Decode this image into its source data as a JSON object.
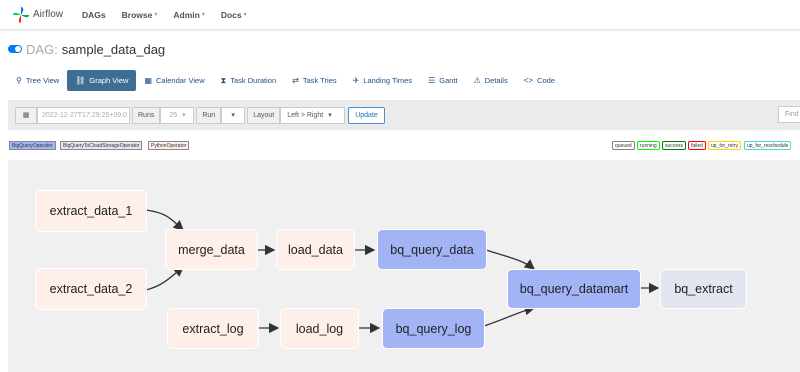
{
  "navbar": {
    "brand": "Airflow",
    "items": [
      {
        "label": "DAGs",
        "caret": false
      },
      {
        "label": "Browse",
        "caret": true
      },
      {
        "label": "Admin",
        "caret": true
      },
      {
        "label": "Docs",
        "caret": true
      }
    ]
  },
  "dag": {
    "prefix": "DAG:",
    "name": "sample_data_dag"
  },
  "tabs": [
    {
      "label": "Tree View",
      "icon": "tree-icon"
    },
    {
      "label": "Graph View",
      "icon": "graph-icon"
    },
    {
      "label": "Calendar View",
      "icon": "calendar-icon"
    },
    {
      "label": "Task Duration",
      "icon": "hourglass-icon"
    },
    {
      "label": "Task Tries",
      "icon": "refresh-icon"
    },
    {
      "label": "Landing Times",
      "icon": "plane-landing-icon"
    },
    {
      "label": "Gantt",
      "icon": "gantt-icon"
    },
    {
      "label": "Details",
      "icon": "warning-icon"
    },
    {
      "label": "Code",
      "icon": "code-icon"
    }
  ],
  "controls": {
    "base_date": "2022-12-27T17:29:25+09:0",
    "runs_label": "Runs",
    "runs_value": "25",
    "run_label": "Run",
    "layout_label": "Layout",
    "layout_value": "Left > Right",
    "update_label": "Update",
    "find_placeholder": "Find"
  },
  "operators": [
    {
      "label": "BigQueryOperator",
      "color": "#a3b4f6"
    },
    {
      "label": "BigQueryToCloudStorageOperator",
      "color": "#e3e6f0"
    },
    {
      "label": "PythonOperator",
      "color": "#ffefeb"
    }
  ],
  "states": [
    {
      "label": "queued",
      "color": "#808080"
    },
    {
      "label": "running",
      "color": "#00ff00"
    },
    {
      "label": "success",
      "color": "#008000"
    },
    {
      "label": "failed",
      "color": "#ff0000"
    },
    {
      "label": "up_for_retry",
      "color": "#ffd700"
    },
    {
      "label": "up_for_reschedule",
      "color": "#40e0d0"
    }
  ],
  "nodes": {
    "extract_data_1": "extract_data_1",
    "extract_data_2": "extract_data_2",
    "merge_data": "merge_data",
    "load_data": "load_data",
    "bq_query_data": "bq_query_data",
    "extract_log": "extract_log",
    "load_log": "load_log",
    "bq_query_log": "bq_query_log",
    "bq_query_datamart": "bq_query_datamart",
    "bq_extract": "bq_extract"
  }
}
